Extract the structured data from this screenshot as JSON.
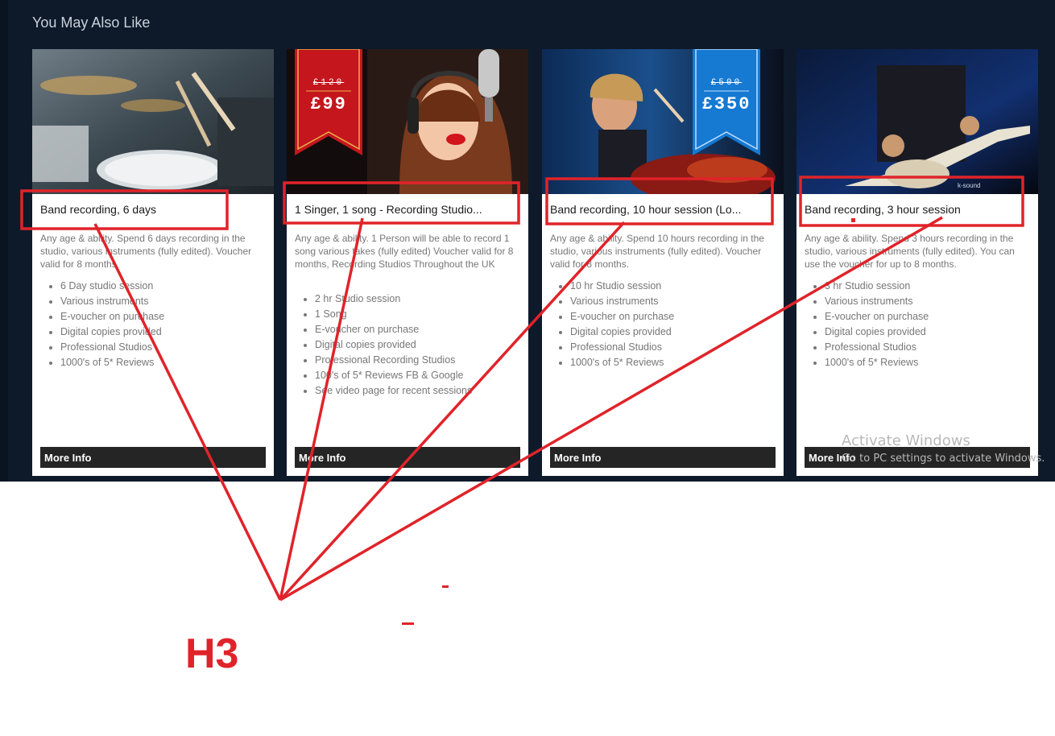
{
  "section": {
    "title": "You May Also Like"
  },
  "cards": [
    {
      "title": "Band recording, 6 days",
      "description": "Any age & ability. Spend 6 days recording in the studio, various instruments (fully edited). Voucher valid for 8 months",
      "features": [
        "6 Day studio session",
        "Various instruments",
        "E-voucher on purchase",
        "Digital copies provided",
        "Professional Studios",
        "1000's of 5* Reviews"
      ],
      "button": "More Info",
      "image": "drum-kit-photo"
    },
    {
      "title": "1 Singer, 1 song - Recording Studio...",
      "description": "Any age & ability. 1 Person will be able to record 1 song various takes (fully edited) Voucher valid for 8 months, Recording Studios Throughout the UK",
      "features": [
        "2 hr Studio session",
        "1 Song",
        "E-voucher on purchase",
        "Digital copies provided",
        "Professional Recording Studios",
        "100's of 5* Reviews FB & Google",
        "See video page for recent sessions"
      ],
      "button": "More Info",
      "image": "singer-with-headphones-photo",
      "ribbon": {
        "old_price": "£120",
        "price": "£99",
        "color": "#c4161c"
      }
    },
    {
      "title": "Band recording, 10 hour session (Lo...",
      "description": "Any age & ability. Spend 10 hours recording in the studio, various instruments (fully edited). Voucher valid for 8 months.",
      "features": [
        "10 hr Studio session",
        "Various instruments",
        "E-voucher on purchase",
        "Digital copies provided",
        "Professional Studios",
        "1000's of 5* Reviews"
      ],
      "button": "More Info",
      "image": "drummer-on-stage-photo",
      "ribbon": {
        "old_price": "£500",
        "price": "£350",
        "color": "#1679d2"
      }
    },
    {
      "title": "Band recording, 3 hour session",
      "description": "Any age & ability. Spend 3 hours recording in the studio, various instruments (fully edited). You can use the voucher for up to 8 months.",
      "features": [
        "3 hr Studio session",
        "Various instruments",
        "E-voucher on purchase",
        "Digital copies provided",
        "Professional Studios",
        "1000's of 5* Reviews"
      ],
      "button": "More Info",
      "image": "bass-guitarist-photo"
    }
  ],
  "watermark": {
    "title": "Activate Windows",
    "subtitle": "Go to PC settings to activate Windows."
  },
  "annotation": {
    "label": "H3",
    "color": "#e0232a"
  }
}
